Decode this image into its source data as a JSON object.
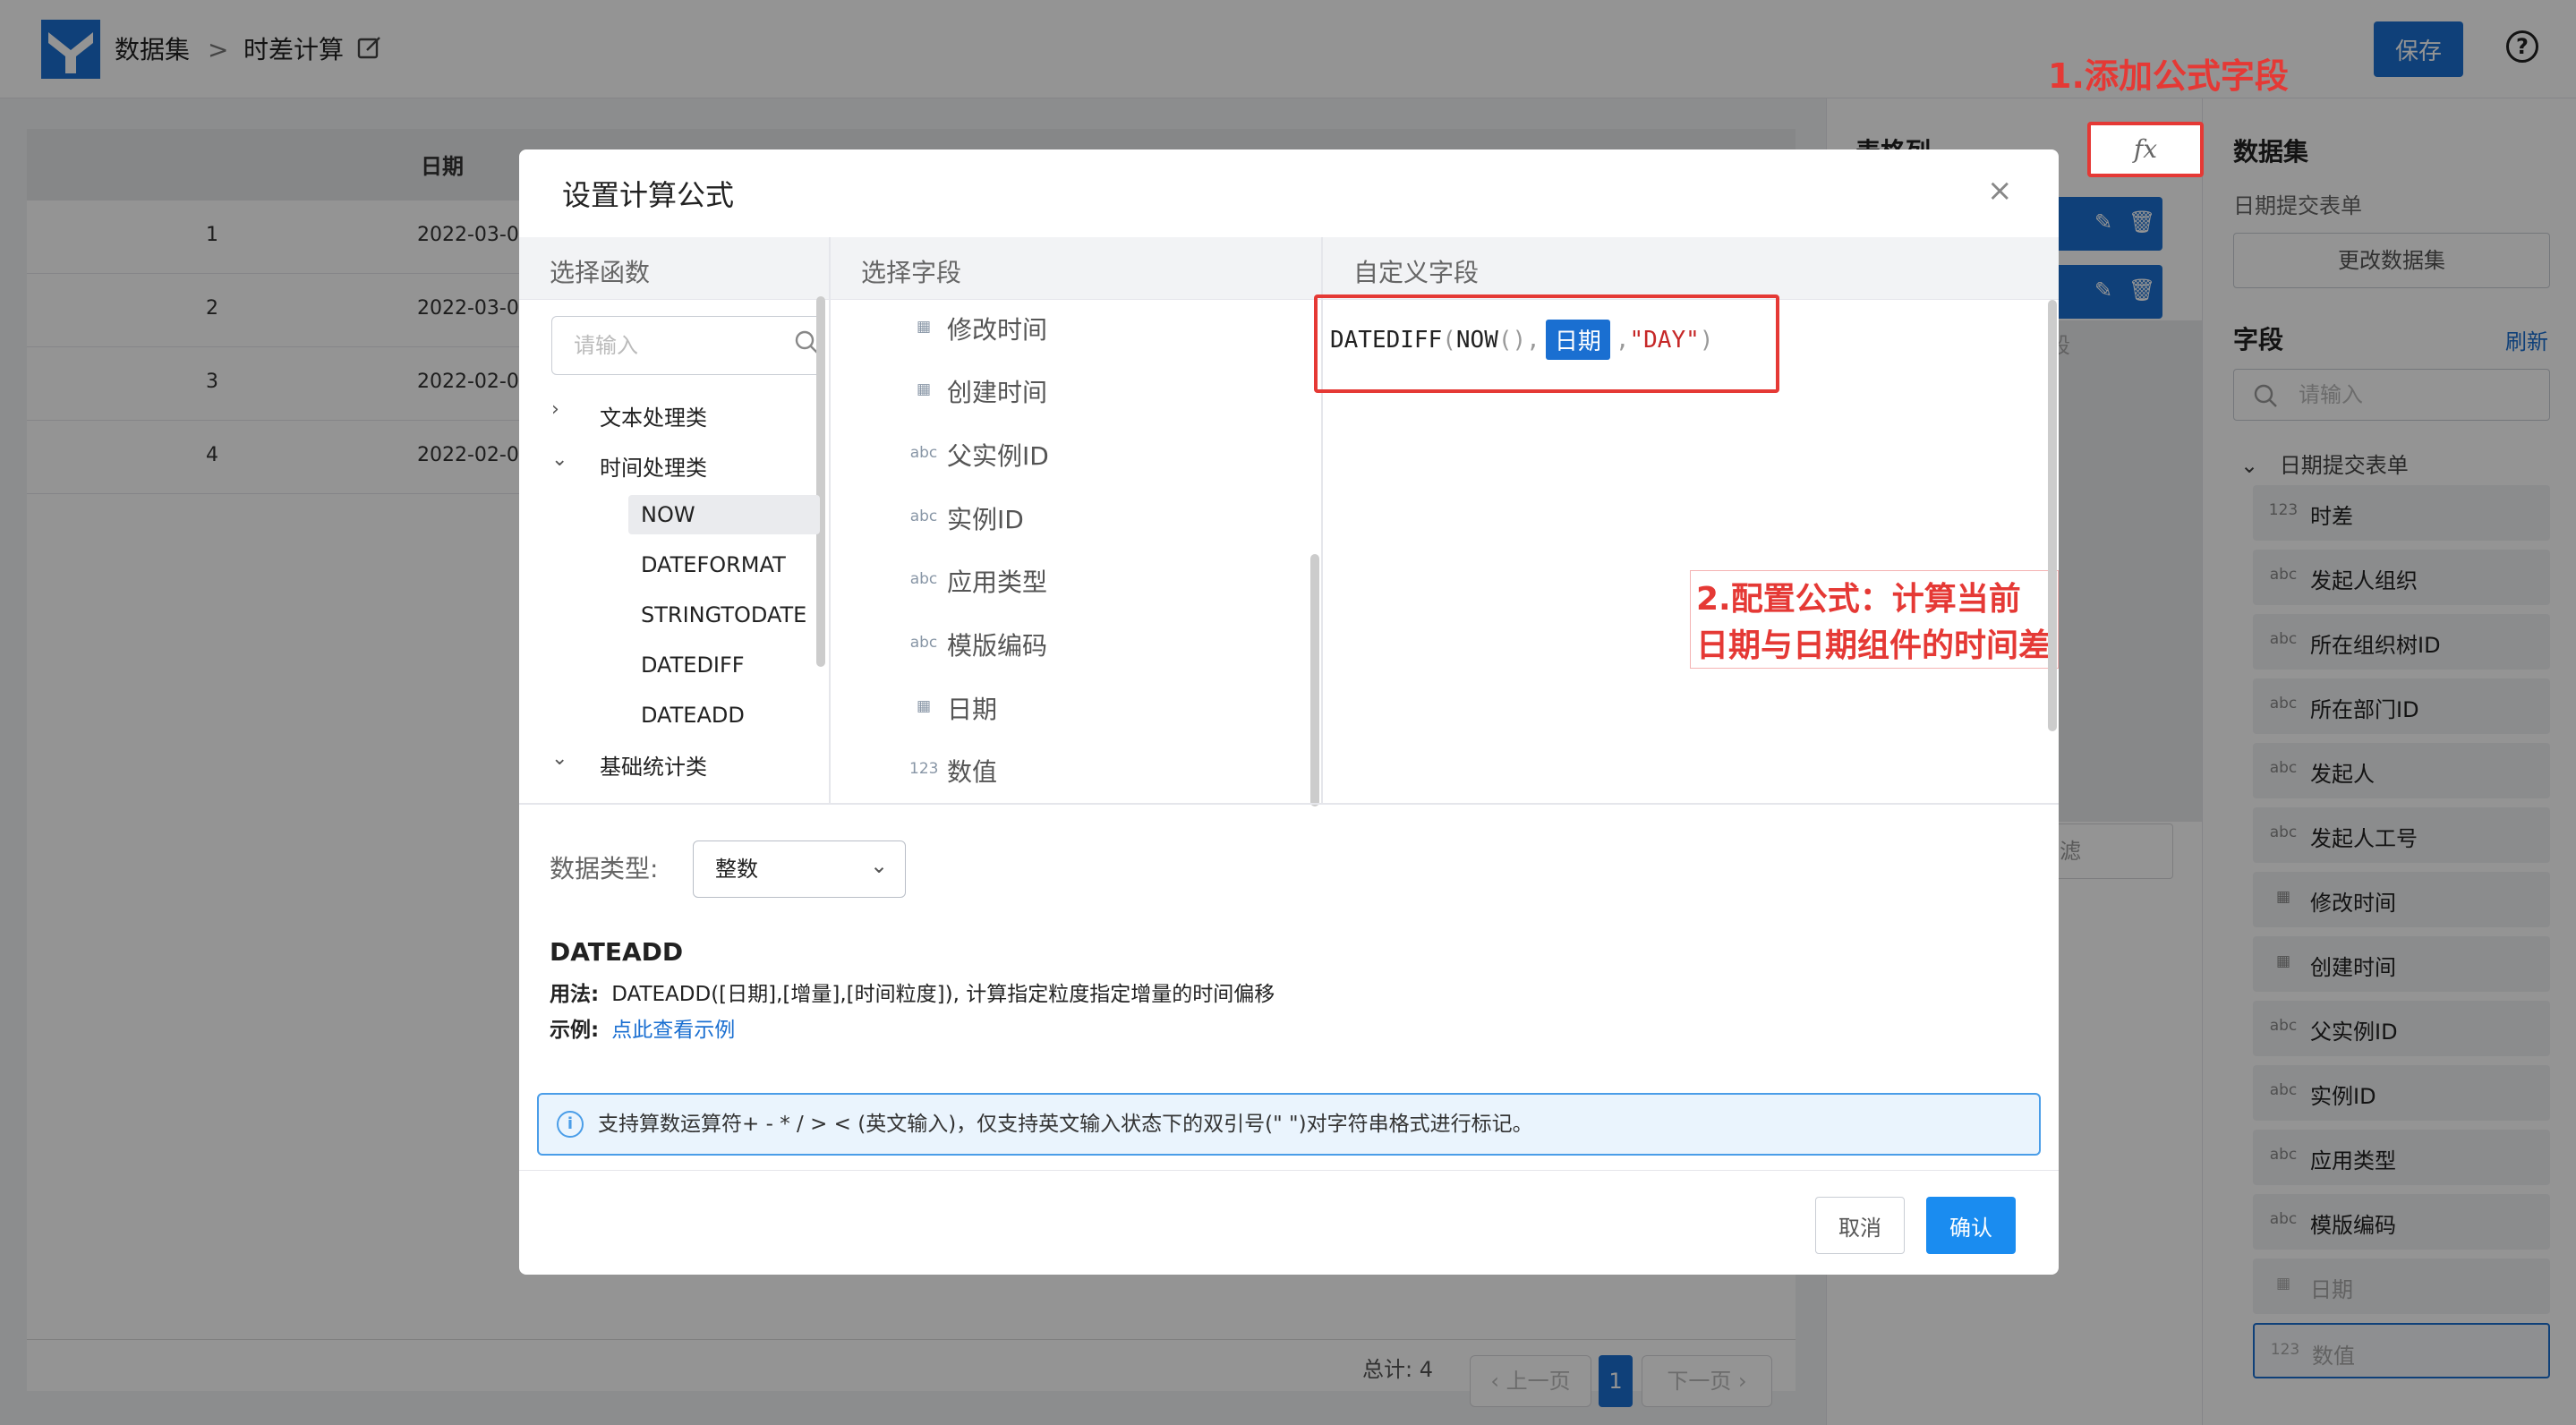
{
  "topbar": {
    "crumb_root": "数据集",
    "crumb_sep": ">",
    "crumb_current": "时差计算",
    "save_label": "保存",
    "help_label": "?"
  },
  "table": {
    "header_date": "日期",
    "rows": [
      {
        "index": "1",
        "date": "2022-03-0"
      },
      {
        "index": "2",
        "date": "2022-03-0"
      },
      {
        "index": "3",
        "date": "2022-02-0"
      },
      {
        "index": "4",
        "date": "2022-02-0"
      }
    ],
    "pager": {
      "total": "总计: 4",
      "prev": "上一页",
      "page": "1",
      "next": "下一页"
    }
  },
  "mid_panel": {
    "title": "表格列",
    "fx_label": "fx",
    "field_hint": "段",
    "filter_label": "滤"
  },
  "right_panel": {
    "title": "数据集",
    "dataset_name": "日期提交表单",
    "change_label": "更改数据集",
    "fields_title": "字段",
    "refresh_label": "刷新",
    "search_placeholder": "请输入",
    "tree_root": "日期提交表单",
    "fields": [
      {
        "icon": "123",
        "label": "时差"
      },
      {
        "icon": "abc",
        "label": "发起人组织"
      },
      {
        "icon": "abc",
        "label": "所在组织树ID"
      },
      {
        "icon": "abc",
        "label": "所在部门ID"
      },
      {
        "icon": "abc",
        "label": "发起人"
      },
      {
        "icon": "abc",
        "label": "发起人工号"
      },
      {
        "icon": "calendar",
        "label": "修改时间"
      },
      {
        "icon": "calendar",
        "label": "创建时间"
      },
      {
        "icon": "abc",
        "label": "父实例ID"
      },
      {
        "icon": "abc",
        "label": "实例ID"
      },
      {
        "icon": "abc",
        "label": "应用类型"
      },
      {
        "icon": "abc",
        "label": "模版编码"
      },
      {
        "icon": "calendar",
        "label": "日期"
      },
      {
        "icon": "123",
        "label": "数值"
      }
    ]
  },
  "annotations": {
    "step1": "1.添加公式字段",
    "step2": "2.配置公式：计算当前日期与日期组件的时间差"
  },
  "modal": {
    "title": "设置计算公式",
    "close": "×",
    "col_functions": "选择函数",
    "col_fields": "选择字段",
    "col_custom": "自定义字段",
    "fn_search_placeholder": "请输入",
    "groups": [
      {
        "label": "文本处理类",
        "expanded": false
      },
      {
        "label": "时间处理类",
        "expanded": true
      },
      {
        "label": "基础统计类",
        "expanded": true
      }
    ],
    "time_functions": [
      "NOW",
      "DATEFORMAT",
      "STRINGTODATE",
      "DATEDIFF",
      "DATEADD"
    ],
    "fields": [
      {
        "icon": "calendar",
        "label": "修改时间"
      },
      {
        "icon": "calendar",
        "label": "创建时间"
      },
      {
        "icon": "abc",
        "label": "父实例ID"
      },
      {
        "icon": "abc",
        "label": "实例ID"
      },
      {
        "icon": "abc",
        "label": "应用类型"
      },
      {
        "icon": "abc",
        "label": "模版编码"
      },
      {
        "icon": "calendar",
        "label": "日期"
      },
      {
        "icon": "123",
        "label": "数值"
      }
    ],
    "formula": {
      "fn": "DATEDIFF",
      "open": "(",
      "now": "NOW",
      "now_parens": "()",
      "comma": ",",
      "field_tag": "日期",
      "str": "\"DAY\"",
      "close": ")"
    },
    "data_type_label": "数据类型:",
    "data_type_value": "整数",
    "fn_name": "DATEADD",
    "usage_label": "用法:",
    "usage_text": "DATEADD([日期],[增量],[时间粒度]), 计算指定粒度指定增量的时间偏移",
    "example_label": "示例:",
    "example_link": "点此查看示例",
    "tip": "支持算数运算符+ - * / > < (英文输入)，仅支持英文输入状态下的双引号(\" \")对字符串格式进行标记。",
    "cancel_label": "取消",
    "ok_label": "确认"
  }
}
